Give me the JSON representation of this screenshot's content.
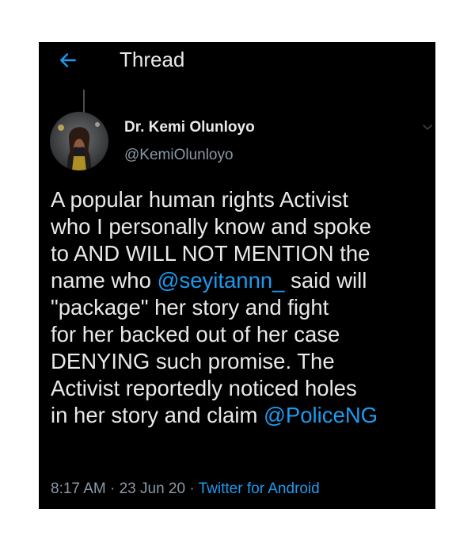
{
  "header": {
    "back_icon": "arrow-left-icon",
    "title": "Thread"
  },
  "tweet": {
    "author": {
      "name": "Dr. Kemi Olunloyo",
      "handle": "@KemiOlunloyo",
      "avatar_icon": "profile-photo"
    },
    "more_icon": "chevron-down-icon",
    "lines": [
      [
        {
          "text": "A popular human rights Activist",
          "type": "text"
        }
      ],
      [
        {
          "text": "who I personally know and spoke",
          "type": "text"
        }
      ],
      [
        {
          "text": "to AND WILL NOT MENTION the",
          "type": "text"
        }
      ],
      [
        {
          "text": "name who ",
          "type": "text"
        },
        {
          "text": "@seyitannn_",
          "type": "mention"
        },
        {
          "text": " said will",
          "type": "text"
        }
      ],
      [
        {
          "text": "\"package\" her story and fight",
          "type": "text"
        }
      ],
      [
        {
          "text": "for her backed out of her case",
          "type": "text"
        }
      ],
      [
        {
          "text": "DENYING such promise. The",
          "type": "text"
        }
      ],
      [
        {
          "text": "Activist reportedly noticed holes",
          "type": "text"
        }
      ],
      [
        {
          "text": "in her story and claim ",
          "type": "text"
        },
        {
          "text": "@PoliceNG",
          "type": "mention"
        }
      ]
    ],
    "time": "8:17 AM",
    "date": "23 Jun 20",
    "separator": " · ",
    "source": "Twitter for Android"
  },
  "colors": {
    "background": "#000000",
    "text": "#e7e9ea",
    "secondary": "#8b98a5",
    "accent": "#1d9bf0"
  }
}
